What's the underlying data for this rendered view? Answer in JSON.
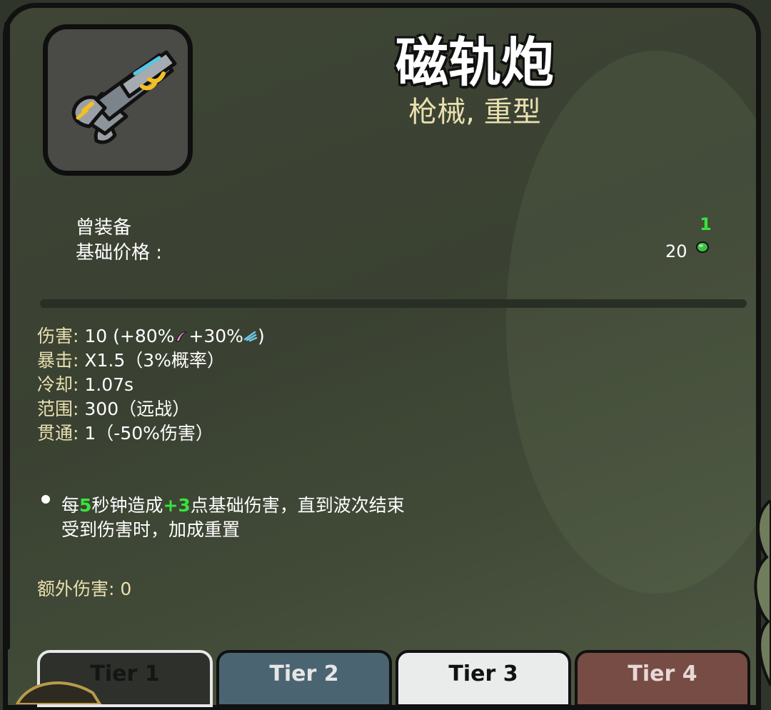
{
  "weapon": {
    "name": "磁轨炮",
    "tags": "枪械, 重型",
    "icon": "railgun-icon"
  },
  "info": {
    "equipped_label": "曾装备",
    "equipped_value": "1",
    "price_label": "基础价格 :",
    "price_value": "20",
    "price_icon": "material-coin-icon"
  },
  "stats": {
    "damage_key": "伤害:",
    "damage_value": "10 (+80%",
    "damage_mid": "+30%",
    "damage_end": ")",
    "crit_key": "暴击:",
    "crit_value": "X1.5（3%概率）",
    "cooldown_key": "冷却:",
    "cooldown_value": "1.07s",
    "range_key": "范围:",
    "range_value": "300（远战）",
    "pierce_key": "贯通:",
    "pierce_value": "1（-50%伤害）"
  },
  "effect": {
    "p1": "每",
    "n1": "5",
    "p2": "秒钟造成",
    "n2": "+3",
    "p3": "点基础伤害，直到波次结束",
    "line2": "受到伤害时，加成重置"
  },
  "extra_damage": "额外伤害: 0",
  "tiers": [
    {
      "label": "Tier 1",
      "bg": "#2e302c",
      "fg": "#151515",
      "border": "#e8e8e8"
    },
    {
      "label": "Tier 2",
      "bg": "#4b6472",
      "fg": "#e6e6e6",
      "border": "#111111"
    },
    {
      "label": "Tier 3",
      "bg": "#e9eceb",
      "fg": "#111111",
      "border": "#111111"
    },
    {
      "label": "Tier 4",
      "bg": "#774c45",
      "fg": "#e6d8d6",
      "border": "#111111"
    }
  ],
  "colors": {
    "accent_green": "#39e23e",
    "title_text": "#ffffff",
    "tag_text": "#e9e0b0"
  }
}
